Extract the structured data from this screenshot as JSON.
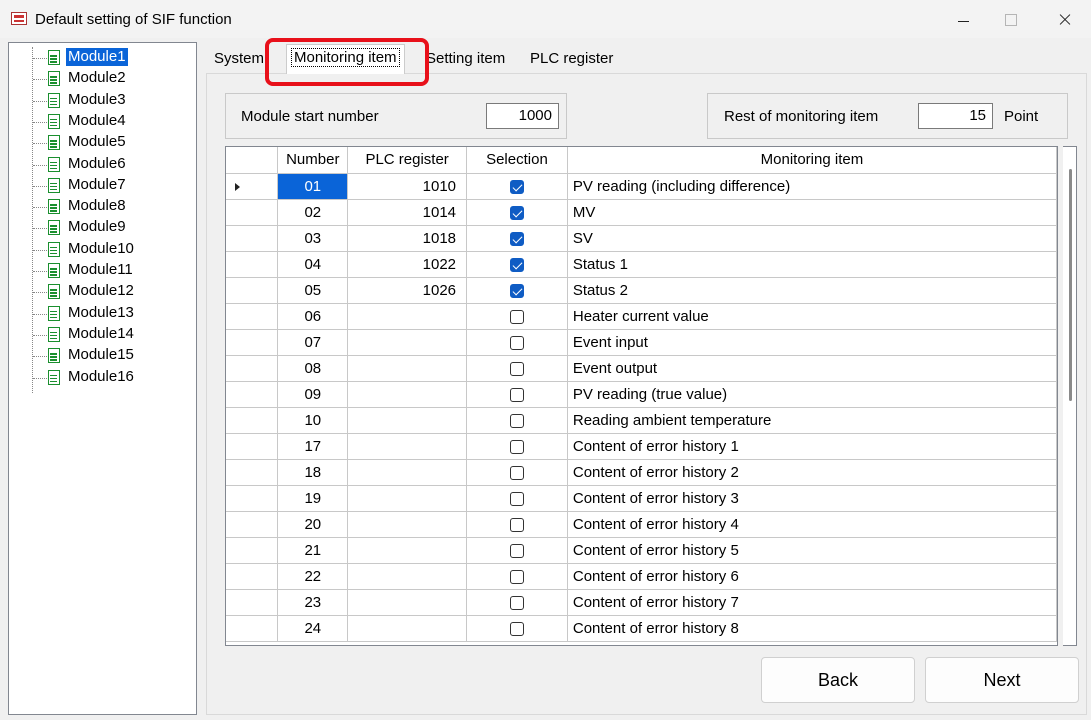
{
  "window": {
    "title": "Default setting of SIF function",
    "icon": "app-icon"
  },
  "tree": {
    "items": [
      "Module1",
      "Module2",
      "Module3",
      "Module4",
      "Module5",
      "Module6",
      "Module7",
      "Module8",
      "Module9",
      "Module10",
      "Module11",
      "Module12",
      "Module13",
      "Module14",
      "Module15",
      "Module16"
    ],
    "selected": "Module1"
  },
  "tabs": {
    "system": "System",
    "monitoring": "Monitoring item",
    "setting": "Setting item",
    "plc": "PLC register",
    "active": "Monitoring item"
  },
  "fields": {
    "module_start_label": "Module start number",
    "module_start_value": "1000",
    "rest_label": "Rest of monitoring item",
    "rest_value": "15",
    "rest_unit": "Point"
  },
  "grid": {
    "headers": {
      "number": "Number",
      "plc": "PLC register",
      "selection": "Selection",
      "item": "Monitoring item"
    },
    "rows": [
      {
        "number": "01",
        "plc": "1010",
        "selected": true,
        "item": "PV reading (including difference)"
      },
      {
        "number": "02",
        "plc": "1014",
        "selected": true,
        "item": "MV"
      },
      {
        "number": "03",
        "plc": "1018",
        "selected": true,
        "item": "SV"
      },
      {
        "number": "04",
        "plc": "1022",
        "selected": true,
        "item": "Status 1"
      },
      {
        "number": "05",
        "plc": "1026",
        "selected": true,
        "item": "Status 2"
      },
      {
        "number": "06",
        "plc": "",
        "selected": false,
        "item": "Heater current value"
      },
      {
        "number": "07",
        "plc": "",
        "selected": false,
        "item": "Event input"
      },
      {
        "number": "08",
        "plc": "",
        "selected": false,
        "item": "Event output"
      },
      {
        "number": "09",
        "plc": "",
        "selected": false,
        "item": "PV reading (true value)"
      },
      {
        "number": "10",
        "plc": "",
        "selected": false,
        "item": "Reading ambient temperature"
      },
      {
        "number": "17",
        "plc": "",
        "selected": false,
        "item": "Content of error history 1"
      },
      {
        "number": "18",
        "plc": "",
        "selected": false,
        "item": "Content of error history 2"
      },
      {
        "number": "19",
        "plc": "",
        "selected": false,
        "item": "Content of error history 3"
      },
      {
        "number": "20",
        "plc": "",
        "selected": false,
        "item": "Content of error history 4"
      },
      {
        "number": "21",
        "plc": "",
        "selected": false,
        "item": "Content of error history 5"
      },
      {
        "number": "22",
        "plc": "",
        "selected": false,
        "item": "Content of error history 6"
      },
      {
        "number": "23",
        "plc": "",
        "selected": false,
        "item": "Content of error history 7"
      },
      {
        "number": "24",
        "plc": "",
        "selected": false,
        "item": "Content of error history 8"
      }
    ],
    "current_row": 0
  },
  "buttons": {
    "back": "Back",
    "next": "Next"
  },
  "colors": {
    "selection_blue": "#0a64d8",
    "checkbox_blue": "#0f5cc4",
    "highlight_red": "#e8101a",
    "tree_icon_green": "#1a8f2e"
  }
}
